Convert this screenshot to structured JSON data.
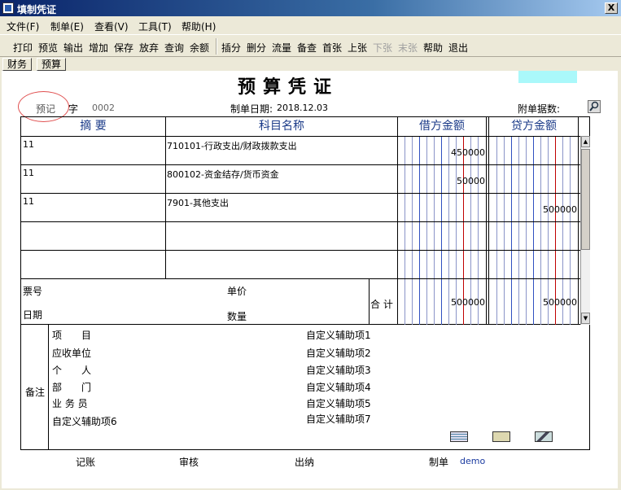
{
  "window": {
    "title": "填制凭证",
    "close_label": "X"
  },
  "menu": [
    "文件(F)",
    "制单(E)",
    "查看(V)",
    "工具(T)",
    "帮助(H)"
  ],
  "toolbar": {
    "group1": [
      "打印",
      "预览",
      "输出",
      "增加",
      "保存",
      "放弃",
      "查询",
      "余额"
    ],
    "group2": [
      "插分",
      "删分",
      "流量",
      "备查",
      "首张",
      "上张",
      "下张",
      "末张",
      "帮助",
      "退出"
    ],
    "disabled": [
      "下张",
      "末张"
    ]
  },
  "tabs": [
    "财务",
    "预算"
  ],
  "voucher": {
    "title": "预算凭证",
    "type_label": "预记",
    "zi_label": "字",
    "number": "0002",
    "date_label": "制单日期:",
    "date": "2018.12.03",
    "attach_label": "附单据数:"
  },
  "grid": {
    "headers": {
      "summary": "摘 要",
      "subject": "科目名称",
      "debit": "借方金额",
      "credit": "贷方金额"
    },
    "rows": [
      {
        "summary": "11",
        "subject": "710101-行政支出/财政拨款支出",
        "debit": "450000",
        "credit": ""
      },
      {
        "summary": "11",
        "subject": "800102-资金结存/货币资金",
        "debit": "50000",
        "credit": ""
      },
      {
        "summary": "11",
        "subject": "7901-其他支出",
        "debit": "",
        "credit": "500000"
      },
      {
        "summary": "",
        "subject": "",
        "debit": "",
        "credit": ""
      },
      {
        "summary": "",
        "subject": "",
        "debit": "",
        "credit": ""
      }
    ],
    "footer": {
      "ticket_label": "票号",
      "date_label": "日期",
      "price_label": "单价",
      "qty_label": "数量",
      "total_label": "合 计",
      "total_debit": "500000",
      "total_credit": "500000"
    }
  },
  "remarks": {
    "label": "备注",
    "left": [
      "项　　目",
      "应收单位",
      "个　　人",
      "部　　门",
      "业 务 员",
      "自定义辅助项6"
    ],
    "right": [
      "自定义辅助项1",
      "自定义辅助项2",
      "自定义辅助项3",
      "自定义辅助项4",
      "自定义辅助项5",
      "自定义辅助项7"
    ]
  },
  "signatures": {
    "post": "记账",
    "audit": "审核",
    "cashier": "出纳",
    "maker": "制单",
    "maker_name": "demo"
  },
  "colors": {
    "header_text": "#1a3a88",
    "red_rule": "#c00000",
    "blue_rule": "#3050c0",
    "cyan_box": "#aaf8fa"
  }
}
